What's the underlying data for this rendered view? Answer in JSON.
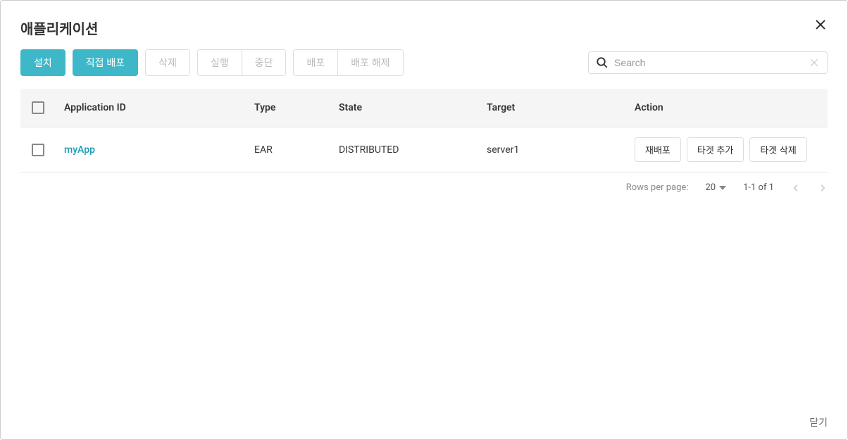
{
  "modal": {
    "title": "애플리케이션",
    "closeLabel": "닫기"
  },
  "toolbar": {
    "install": "설치",
    "directDeploy": "직접 배포",
    "delete": "삭제",
    "run": "실행",
    "stop": "중단",
    "deploy": "배포",
    "undeploy": "배포 해제"
  },
  "search": {
    "placeholder": "Search"
  },
  "table": {
    "headers": {
      "appId": "Application ID",
      "type": "Type",
      "state": "State",
      "target": "Target",
      "action": "Action"
    },
    "rows": [
      {
        "appId": "myApp",
        "type": "EAR",
        "state": "DISTRIBUTED",
        "target": "server1"
      }
    ],
    "actions": {
      "redeploy": "재배포",
      "addTarget": "타겟 추가",
      "deleteTarget": "타겟 삭제"
    }
  },
  "pagination": {
    "rowsPerPageLabel": "Rows per page:",
    "rowsPerPage": "20",
    "pageInfo": "1-1 of 1"
  }
}
